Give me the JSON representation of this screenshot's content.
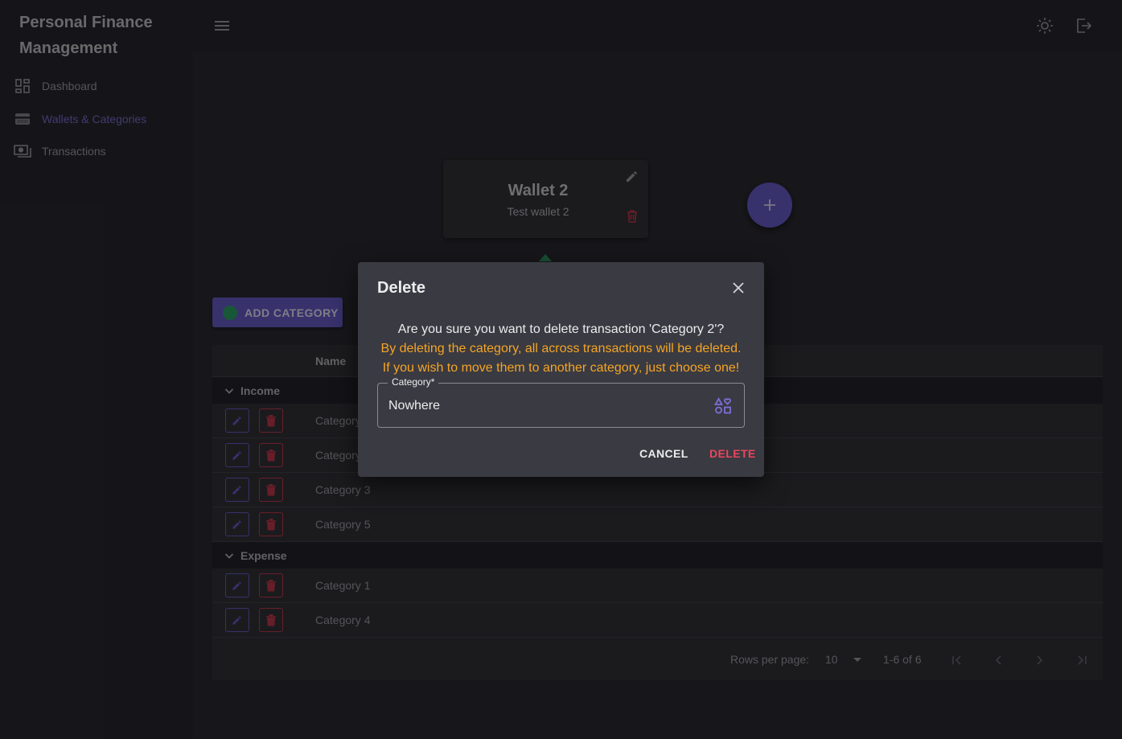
{
  "app": {
    "title": "Personal Finance Management"
  },
  "sidebar": {
    "items": [
      {
        "label": "Dashboard",
        "icon": "dashboard-icon"
      },
      {
        "label": "Wallets & Categories",
        "icon": "wallet-icon",
        "active": true
      },
      {
        "label": "Transactions",
        "icon": "transactions-icon"
      }
    ]
  },
  "topbar": {
    "icons": [
      "menu-icon",
      "theme-toggle-icon",
      "logout-icon"
    ]
  },
  "wallet": {
    "name": "Wallet 2",
    "description": "Test wallet 2"
  },
  "actions": {
    "add_category": "ADD CATEGORY"
  },
  "table": {
    "column_name": "Name",
    "groups": [
      {
        "label": "Income",
        "rows": [
          "Category 2",
          "Category 6",
          "Category 3",
          "Category 5"
        ]
      },
      {
        "label": "Expense",
        "rows": [
          "Category 1",
          "Category 4"
        ]
      }
    ]
  },
  "pagination": {
    "rows_per_page_label": "Rows per page:",
    "rows_per_page": "10",
    "range": "1-6 of 6"
  },
  "dialog": {
    "title": "Delete",
    "question": "Are you sure you want to delete transaction 'Category 2'?",
    "warning_line1": "By deleting the category, all across transactions will be deleted.",
    "warning_line2": "If you wish to move them to another category, just choose one!",
    "field_label": "Category*",
    "field_value": "Nowhere",
    "cancel": "CANCEL",
    "delete": "DELETE"
  },
  "colors": {
    "accent": "#6a5fcf",
    "danger": "#c83a4f",
    "warning": "#f5a524",
    "success": "#2eaa6a"
  }
}
